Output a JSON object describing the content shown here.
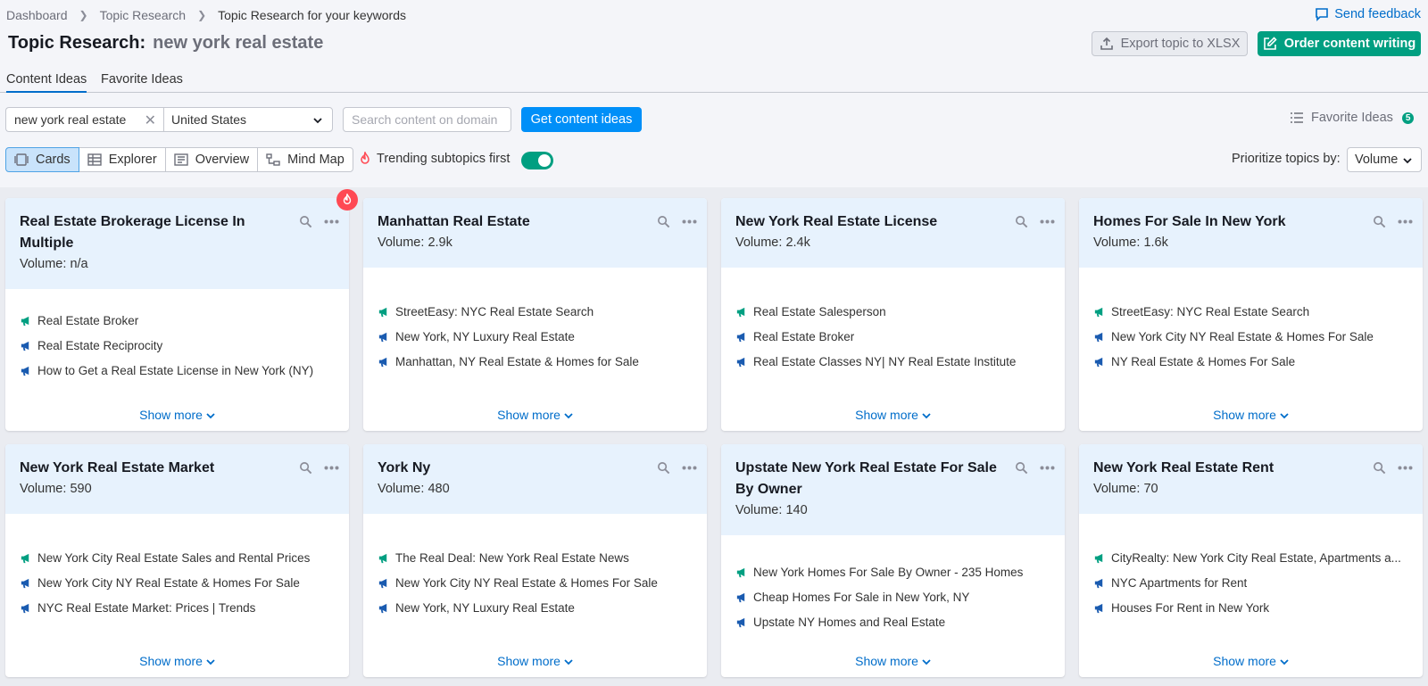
{
  "breadcrumb": [
    "Dashboard",
    "Topic Research",
    "Topic Research for your keywords"
  ],
  "send_feedback": "Send feedback",
  "title": {
    "label": "Topic Research:",
    "keyword": "new york real estate"
  },
  "buttons": {
    "export": "Export topic to XLSX",
    "order": "Order content writing",
    "get_ideas": "Get content ideas"
  },
  "tabs": [
    "Content Ideas",
    "Favorite Ideas"
  ],
  "search": {
    "keyword": "new york real estate",
    "country": "United States",
    "domain_placeholder": "Search content on domain"
  },
  "favorite_ideas": {
    "label": "Favorite Ideas",
    "count": "5"
  },
  "views": [
    "Cards",
    "Explorer",
    "Overview",
    "Mind Map"
  ],
  "trending": {
    "label": "Trending subtopics first",
    "enabled": true
  },
  "prioritize": {
    "label": "Prioritize topics by:",
    "value": "Volume"
  },
  "colors": {
    "accent_blue": "#006dca",
    "button_blue": "#008ff8",
    "green": "#009f81",
    "card_head": "#e7f2fd",
    "fire": "#ff4953"
  },
  "show_more": "Show more",
  "cards": [
    {
      "title": "Real Estate Brokerage License In Multiple",
      "volume_label": "Volume:",
      "volume": "n/a",
      "trending": true,
      "items": [
        {
          "text": "Real Estate Broker",
          "icon": "green"
        },
        {
          "text": "Real Estate Reciprocity",
          "icon": "blue"
        },
        {
          "text": "How to Get a Real Estate License in New York (NY)",
          "icon": "blue"
        }
      ]
    },
    {
      "title": "Manhattan Real Estate",
      "volume_label": "Volume:",
      "volume": "2.9k",
      "items": [
        {
          "text": "StreetEasy: NYC Real Estate Search",
          "icon": "green"
        },
        {
          "text": "New York, NY Luxury Real Estate",
          "icon": "blue"
        },
        {
          "text": "Manhattan, NY Real Estate & Homes for Sale",
          "icon": "blue"
        }
      ]
    },
    {
      "title": "New York Real Estate License",
      "volume_label": "Volume:",
      "volume": "2.4k",
      "items": [
        {
          "text": "Real Estate Salesperson",
          "icon": "green"
        },
        {
          "text": "Real Estate Broker",
          "icon": "blue"
        },
        {
          "text": "Real Estate Classes NY| NY Real Estate Institute",
          "icon": "blue"
        }
      ]
    },
    {
      "title": "Homes For Sale In New York",
      "volume_label": "Volume:",
      "volume": "1.6k",
      "items": [
        {
          "text": "StreetEasy: NYC Real Estate Search",
          "icon": "green"
        },
        {
          "text": "New York City NY Real Estate & Homes For Sale",
          "icon": "blue"
        },
        {
          "text": "NY Real Estate & Homes For Sale",
          "icon": "blue"
        }
      ]
    },
    {
      "title": "New York Real Estate Market",
      "volume_label": "Volume:",
      "volume": "590",
      "items": [
        {
          "text": "New York City Real Estate Sales and Rental Prices",
          "icon": "green"
        },
        {
          "text": "New York City NY Real Estate & Homes For Sale",
          "icon": "blue"
        },
        {
          "text": "NYC Real Estate Market: Prices | Trends",
          "icon": "blue"
        }
      ]
    },
    {
      "title": "York Ny",
      "volume_label": "Volume:",
      "volume": "480",
      "items": [
        {
          "text": "The Real Deal: New York Real Estate News",
          "icon": "green"
        },
        {
          "text": "New York City NY Real Estate & Homes For Sale",
          "icon": "blue"
        },
        {
          "text": "New York, NY Luxury Real Estate",
          "icon": "blue"
        }
      ]
    },
    {
      "title": "Upstate New York Real Estate For Sale By Owner",
      "volume_label": "Volume:",
      "volume": "140",
      "items": [
        {
          "text": "New York Homes For Sale By Owner - 235 Homes",
          "icon": "green"
        },
        {
          "text": "Cheap Homes For Sale in New York, NY",
          "icon": "blue"
        },
        {
          "text": "Upstate NY Homes and Real Estate",
          "icon": "blue"
        }
      ]
    },
    {
      "title": "New York Real Estate Rent",
      "volume_label": "Volume:",
      "volume": "70",
      "items": [
        {
          "text": "CityRealty: New York City Real Estate, Apartments a...",
          "icon": "green"
        },
        {
          "text": "NYC Apartments for Rent",
          "icon": "blue"
        },
        {
          "text": "Houses For Rent in New York",
          "icon": "blue"
        }
      ]
    }
  ]
}
